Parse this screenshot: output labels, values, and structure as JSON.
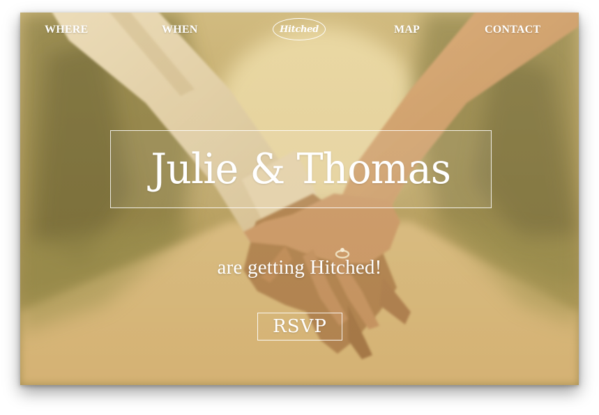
{
  "nav": {
    "items": [
      {
        "label": "WHERE"
      },
      {
        "label": "WHEN"
      },
      {
        "label": "MAP"
      },
      {
        "label": "CONTACT"
      }
    ],
    "logo_text": "Hitched"
  },
  "hero": {
    "title": "Julie & Thomas",
    "tagline": "are getting Hitched!",
    "rsvp_label": "RSVP",
    "background_description_icon": "holding-hands-photo"
  },
  "colors": {
    "text": "#ffffff",
    "photo_tone": "#c9a866"
  }
}
